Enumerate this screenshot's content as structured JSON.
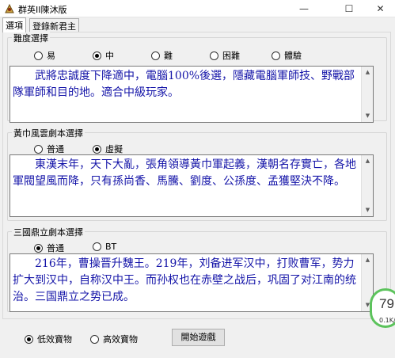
{
  "window": {
    "title": "群英II陳沐版",
    "minimize_glyph": "—",
    "maximize_glyph": "☐",
    "close_glyph": "✕"
  },
  "tabs": [
    {
      "label": "選項",
      "active": true
    },
    {
      "label": "登錄新君主",
      "active": false
    }
  ],
  "difficulty": {
    "title": "難度選擇",
    "options": [
      "易",
      "中",
      "難",
      "困難",
      "體驗"
    ],
    "selected": "中",
    "description": "武將忠誠度下降適中，電腦100%後選，隱藏電腦軍師技、野戰部隊軍師和目的地。適合中級玩家。"
  },
  "yellow_turban": {
    "title": "黃巾風雲劇本選擇",
    "options": [
      "普通",
      "虛擬"
    ],
    "selected": "虛擬",
    "description": "東漢末年，天下大亂，張角領導黃巾軍起義，漢朝名存實亡，各地軍閥望風而降，只有孫尚香、馬騰、劉度、公孫度、孟獲堅決不降。"
  },
  "three_kingdoms": {
    "title": "三國鼎立劇本選擇",
    "options": [
      "普通",
      "BT"
    ],
    "selected": "普通",
    "description": "216年，曹操晋升魏王。219年，刘备进军汉中，打败曹军，势力扩大到汉中，自称汉中王。而孙权也在赤壁之战后，巩固了对江南的统治。三国鼎立之势已成。"
  },
  "treasure": {
    "options": [
      "低效寶物",
      "高效寶物"
    ],
    "selected": "低效寶物"
  },
  "start_button": {
    "label": "開始遊戲"
  },
  "speed_widget": {
    "percent": "79",
    "rate": "0.1K/s",
    "ring_color": "#5cc35c"
  },
  "colors": {
    "description_text": "#1414a8"
  }
}
